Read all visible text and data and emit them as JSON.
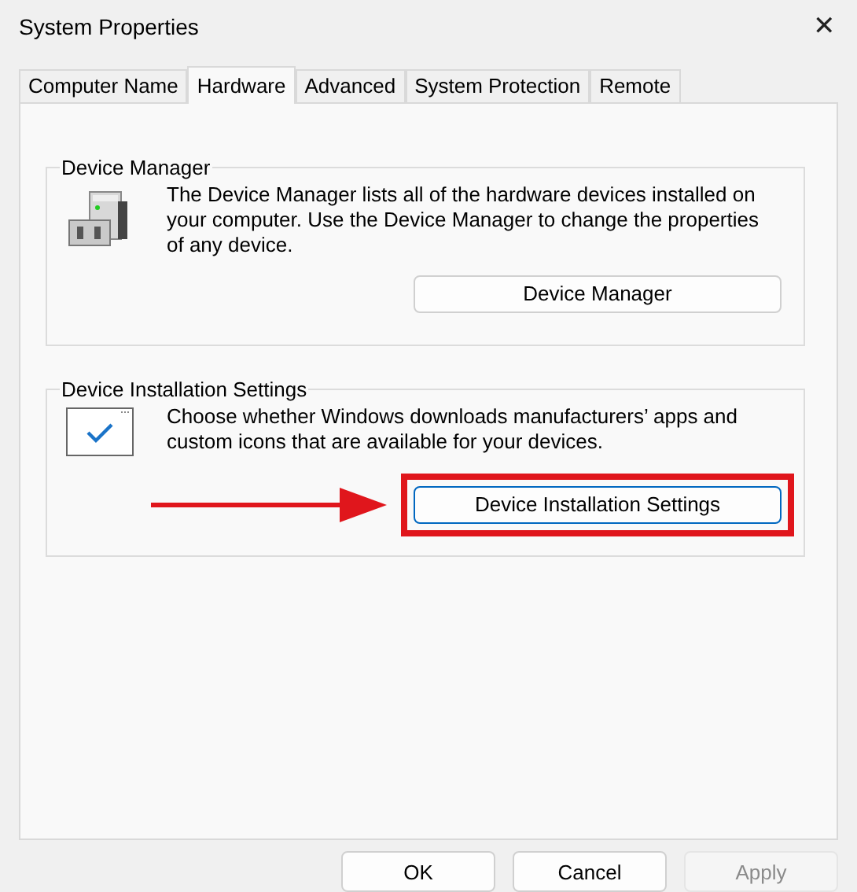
{
  "window": {
    "title": "System Properties",
    "close": "✕"
  },
  "tabs": [
    {
      "label": "Computer Name",
      "selected": false
    },
    {
      "label": "Hardware",
      "selected": true
    },
    {
      "label": "Advanced",
      "selected": false
    },
    {
      "label": "System Protection",
      "selected": false
    },
    {
      "label": "Remote",
      "selected": false
    }
  ],
  "groups": [
    {
      "kind": "device-manager",
      "title": "Device Manager",
      "text": "The Device Manager lists all of the hardware devices installed on your computer. Use the Device Manager to change the properties of any device.",
      "button": "Device Manager",
      "highlighted": false
    },
    {
      "kind": "installation",
      "title": "Device Installation Settings",
      "text": "Choose whether Windows downloads manufacturers’ apps and custom icons that are available for your devices.",
      "button": "Device Installation Settings",
      "highlighted": true
    }
  ],
  "buttons": [
    {
      "label": "OK",
      "disabled": false
    },
    {
      "label": "Cancel",
      "disabled": false
    },
    {
      "label": "Apply",
      "disabled": true
    }
  ]
}
